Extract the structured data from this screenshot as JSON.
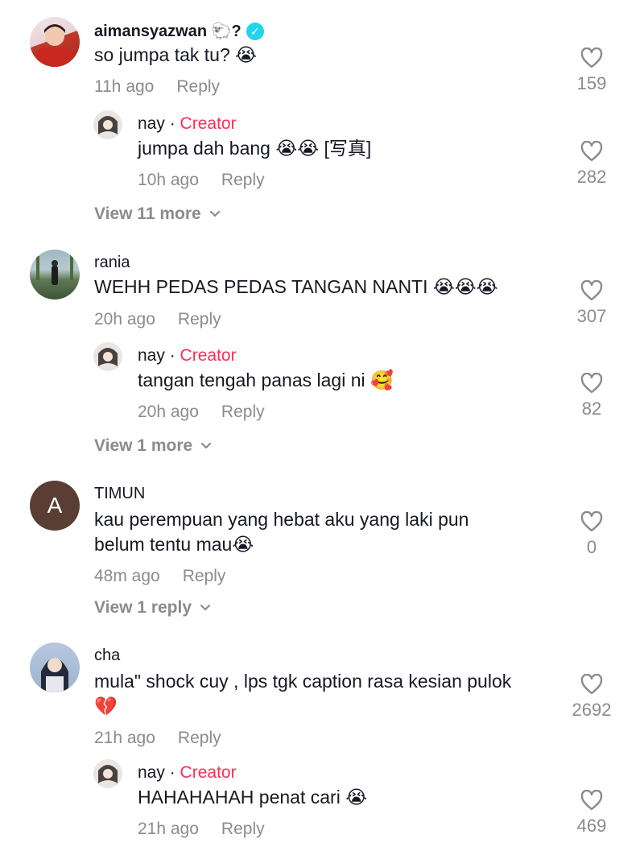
{
  "comments": [
    {
      "username": "aimansyazwan",
      "username_suffix": "🐑?",
      "verified_icon": "✓",
      "text": "so jumpa tak tu? 😭",
      "time": "11h ago",
      "reply_label": "Reply",
      "likes": "159",
      "replies": [
        {
          "username": "nay",
          "separator": "·",
          "creator_label": "Creator",
          "text": "jumpa dah bang 😭😭 [写真]",
          "time": "10h ago",
          "reply_label": "Reply",
          "likes": "282"
        }
      ],
      "view_more": "View 11 more"
    },
    {
      "username": "rania",
      "text": "WEHH PEDAS PEDAS TANGAN NANTI 😭😭😭",
      "time": "20h ago",
      "reply_label": "Reply",
      "likes": "307",
      "replies": [
        {
          "username": "nay",
          "separator": "·",
          "creator_label": "Creator",
          "text": "tangan tengah panas lagi ni 🥰",
          "time": "20h ago",
          "reply_label": "Reply",
          "likes": "82"
        }
      ],
      "view_more": "View 1 more"
    },
    {
      "username": "TIMUN",
      "avatar_letter": "A",
      "text_line1": "kau perempuan yang hebat aku yang laki pun",
      "text_line2": "belum tentu mau😭",
      "time": "48m ago",
      "reply_label": "Reply",
      "likes": "0",
      "view_more": "View 1 reply"
    },
    {
      "username": "cha",
      "text_line1": "mula\" shock cuy , lps tgk caption rasa kesian pulok",
      "text_line2": "💔",
      "time": "21h ago",
      "reply_label": "Reply",
      "likes": "2692",
      "replies": [
        {
          "username": "nay",
          "separator": "·",
          "creator_label": "Creator",
          "text": "HAHAHAHAH penat cari 😭",
          "time": "21h ago",
          "reply_label": "Reply",
          "likes": "469"
        }
      ]
    }
  ],
  "colors": {
    "creator": "#FE2C55",
    "meta_gray": "#8a8b91",
    "text": "#161823",
    "verified": "#20D5EC",
    "timun_avatar_bg": "#5a3d33"
  },
  "icons": {
    "like": "heart-outline-icon",
    "expand": "chevron-down-icon",
    "verified": "verified-badge-icon"
  }
}
